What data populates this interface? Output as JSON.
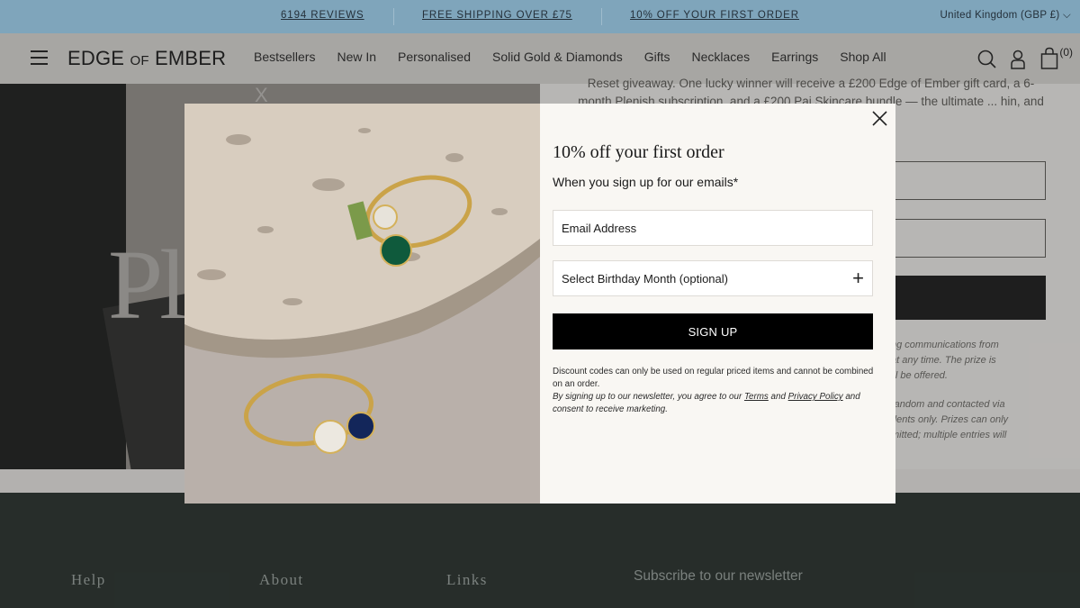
{
  "announcement": {
    "reviews": "6194 REVIEWS",
    "shipping": "FREE SHIPPING OVER £75",
    "discount": "10% OFF YOUR FIRST ORDER",
    "region": "United Kingdom (GBP £)"
  },
  "header": {
    "logo_edge": "EDGE",
    "logo_of": "OF",
    "logo_ember": "EMBER",
    "nav": [
      "Bestsellers",
      "New In",
      "Personalised",
      "Solid Gold & Diamonds",
      "Gifts",
      "Necklaces",
      "Earrings",
      "Shop All"
    ],
    "cart_count": "(0)"
  },
  "background": {
    "hero_text": "Pl",
    "hero_close": "X",
    "paragraph": "Reset giveaway. One lucky winner will receive a £200 Edge of Ember gift card, a 6-month Plenish subscription, and a £200 Pai Skincare bundle — the ultimate ... hin, and step into spring",
    "small_lines": [
      "ng communications from",
      "at any time. The prize is",
      "ill be offered.",
      "random and contacted via",
      "dents only. Prizes can only",
      "mitted; multiple entries will"
    ]
  },
  "footer": {
    "help": "Help",
    "about": "About",
    "links": "Links",
    "subscribe": "Subscribe to our newsletter"
  },
  "modal": {
    "title": "10% off your first order",
    "subtitle": "When you sign up for our emails*",
    "email_placeholder": "Email Address",
    "birthday_label": "Select Birthday Month (optional)",
    "signup_label": "SIGN UP",
    "fine_print_1": "Discount codes can only be used on regular priced items and cannot be combined on an order.",
    "fine_print_2_prefix": "By signing up to our newsletter, you agree to our",
    "terms_label": "Terms",
    "and_label": "and",
    "privacy_label": "Privacy Policy",
    "fine_print_2_suffix": "and consent to receive marketing."
  },
  "colors": {
    "announcement_bg": "#7fa5bb",
    "header_bg": "#d9d7d3",
    "footer_bg": "#27302c",
    "modal_bg": "#f9f7f3",
    "button_bg": "#000000"
  }
}
